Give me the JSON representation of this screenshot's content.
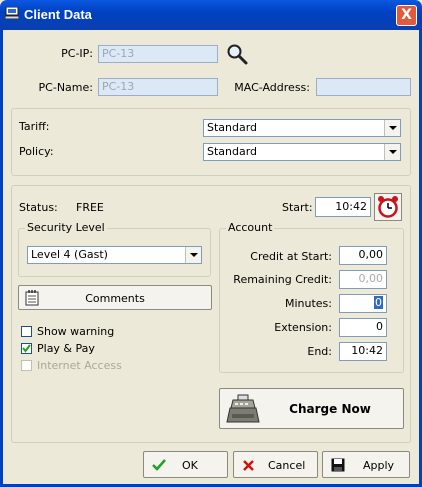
{
  "window": {
    "title": "Client Data",
    "close_label": "X"
  },
  "pc": {
    "ip_label": "PC-IP:",
    "ip_value": "PC-13",
    "name_label": "PC-Name:",
    "name_value": "PC-13",
    "mac_label": "MAC-Address:",
    "mac_value": ""
  },
  "settings": {
    "tariff_label": "Tariff:",
    "tariff_value": "Standard",
    "policy_label": "Policy:",
    "policy_value": "Standard"
  },
  "status": {
    "label": "Status:",
    "value": "FREE",
    "start_label": "Start:",
    "start_value": "10:42"
  },
  "security": {
    "legend": "Security Level",
    "value": "Level 4 (Gast)"
  },
  "comments_label": "Comments",
  "options": {
    "show_warning": {
      "label": "Show warning",
      "checked": false
    },
    "play_pay": {
      "label": "Play & Pay",
      "checked": true
    },
    "internet_access": {
      "label": "Internet Access",
      "checked": false,
      "disabled": true
    }
  },
  "account": {
    "legend": "Account",
    "credit_start_label": "Credit at Start:",
    "credit_start_value": "0,00",
    "remaining_label": "Remaining Credit:",
    "remaining_value": "0,00",
    "minutes_label": "Minutes:",
    "minutes_value": "0",
    "extension_label": "Extension:",
    "extension_value": "0",
    "end_label": "End:",
    "end_value": "10:42"
  },
  "charge_label": "Charge Now",
  "buttons": {
    "ok": "OK",
    "cancel": "Cancel",
    "apply": "Apply"
  }
}
